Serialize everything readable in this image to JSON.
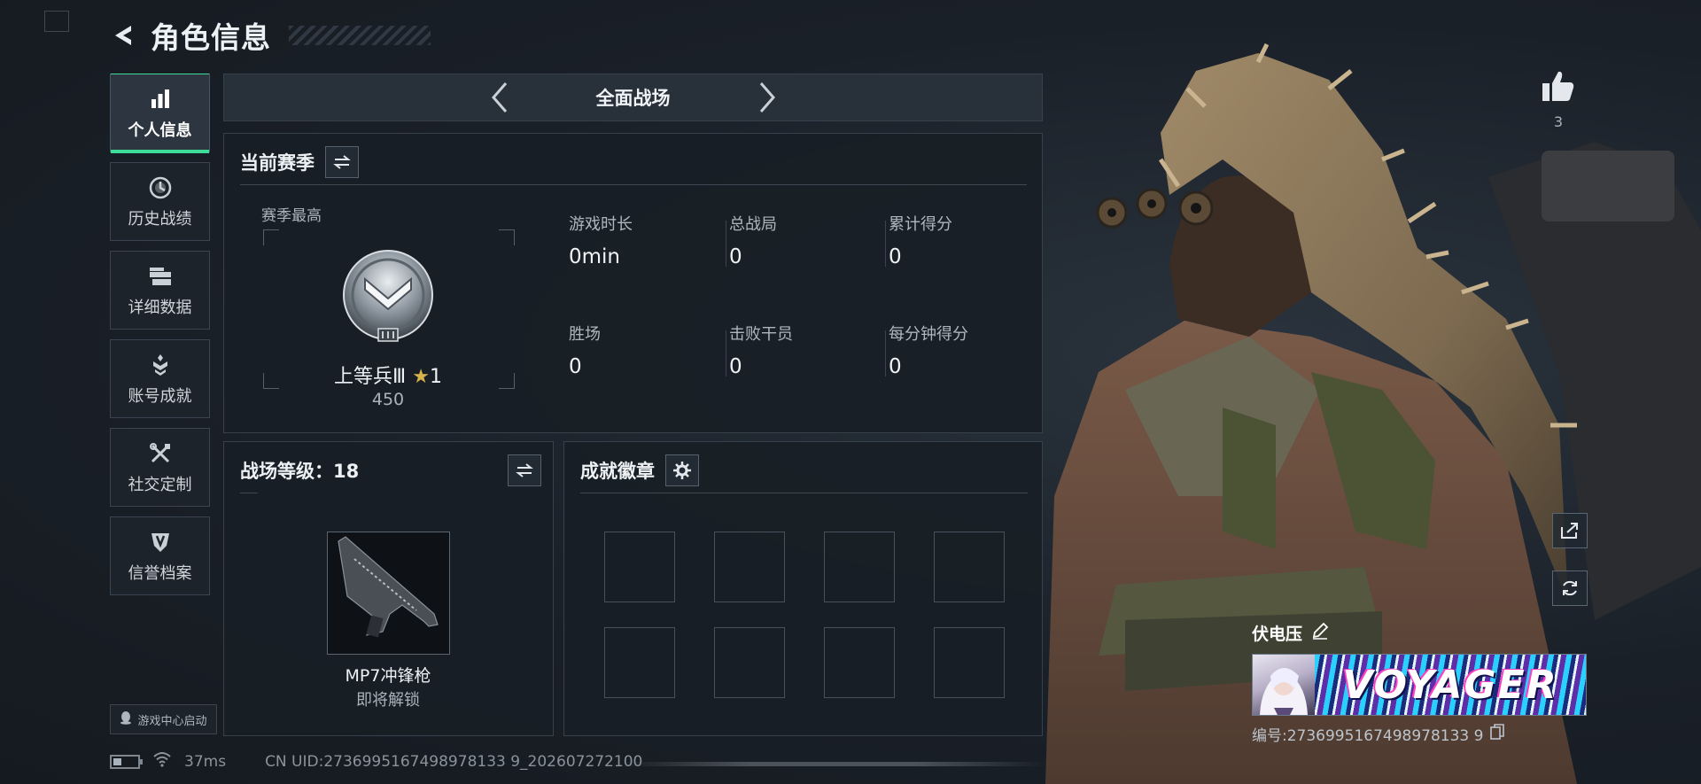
{
  "header": {
    "title": "角色信息"
  },
  "nav": {
    "items": [
      {
        "label": "个人信息",
        "icon": "bar-chart-icon",
        "active": true
      },
      {
        "label": "历史战绩",
        "icon": "history-clock-icon",
        "active": false
      },
      {
        "label": "详细数据",
        "icon": "folder-icon",
        "active": false
      },
      {
        "label": "账号成就",
        "icon": "achievement-icon",
        "active": false
      },
      {
        "label": "社交定制",
        "icon": "tools-icon",
        "active": false
      },
      {
        "label": "信誉档案",
        "icon": "shield-icon",
        "active": false
      }
    ],
    "launch_label": "游戏中心启动"
  },
  "mode": {
    "title": "全面战场"
  },
  "season": {
    "title": "当前赛季",
    "best_label": "赛季最高",
    "rank_name": "上等兵Ⅲ",
    "rank_stars": "1",
    "rank_points": "450",
    "stats": [
      {
        "label": "游戏时长",
        "value": "0min"
      },
      {
        "label": "总战局",
        "value": "0"
      },
      {
        "label": "累计得分",
        "value": "0"
      },
      {
        "label": "胜场",
        "value": "0"
      },
      {
        "label": "击败干员",
        "value": "0"
      },
      {
        "label": "每分钟得分",
        "value": "0"
      }
    ]
  },
  "level": {
    "title": "战场等级：18",
    "weapon_name": "MP7冲锋枪",
    "weapon_status": "即将解锁"
  },
  "achievements": {
    "title": "成就徽章",
    "slots": 8
  },
  "footer": {
    "ping": "37ms",
    "uid": "CN UID:2736995167498978133 9_202607272100"
  },
  "character": {
    "likes": "3",
    "player_name": "伏电压",
    "banner_text": "VOYAGER",
    "player_id": "编号:2736995167498978133 9"
  },
  "colors": {
    "accent": "#3ddc97",
    "background": "#1b2129",
    "panel": "#181e25"
  }
}
